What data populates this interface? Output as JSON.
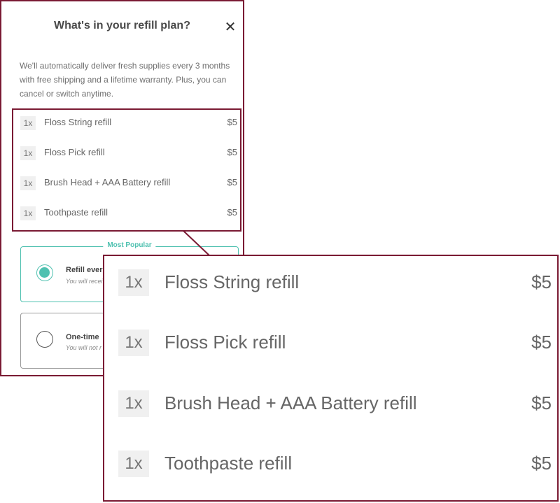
{
  "modal": {
    "title": "What's in your refill plan?",
    "close_symbol": "✕",
    "description": "We'll automatically deliver fresh supplies every 3 months with free shipping and a lifetime warranty. Plus, you can cancel or switch anytime."
  },
  "items": [
    {
      "qty": "1x",
      "name": "Floss String refill",
      "price": "$5"
    },
    {
      "qty": "1x",
      "name": "Floss Pick refill",
      "price": "$5"
    },
    {
      "qty": "1x",
      "name": "Brush Head + AAA Battery refill",
      "price": "$5"
    },
    {
      "qty": "1x",
      "name": "Toothpaste refill",
      "price": "$5"
    }
  ],
  "plans": [
    {
      "badge": "Most Popular",
      "title": "Refill ever",
      "subtitle": "You will recei",
      "selected": true
    },
    {
      "title": "One-time",
      "subtitle": "You will not r",
      "selected": false
    }
  ],
  "colors": {
    "highlight_border": "#7a1a33",
    "accent_teal": "#4fc1b0"
  }
}
